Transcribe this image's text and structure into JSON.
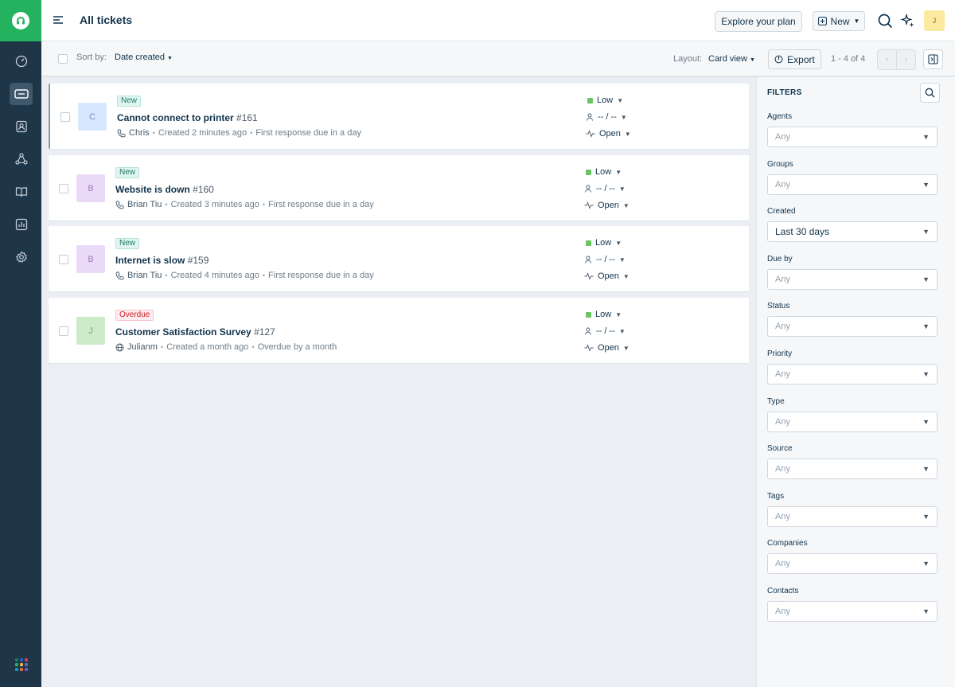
{
  "header": {
    "title": "All tickets",
    "explore_label": "Explore your plan",
    "new_label": "New",
    "avatar_initial": "J"
  },
  "rail": {
    "icons": [
      "dashboard-icon",
      "tickets-icon",
      "contacts-icon",
      "social-icon",
      "solutions-icon",
      "reports-icon",
      "admin-icon"
    ],
    "active": "tickets-icon",
    "app_dot_colors": [
      "#1b7a5a",
      "#2c5cc5",
      "#e63946",
      "#25b25f",
      "#f0ad4e",
      "#5c6bc0",
      "#00a3bf",
      "#e36c35",
      "#7e57c2"
    ]
  },
  "toolbar": {
    "sort_label": "Sort by:",
    "sort_value": "Date created",
    "layout_label": "Layout:",
    "layout_value": "Card view",
    "export_label": "Export",
    "page_info": "1 - 4 of 4"
  },
  "tickets": [
    {
      "initial": "C",
      "avatar_bg": "#d7e7ff",
      "avatar_fg": "#6f8fb5",
      "badge": "New",
      "badge_type": "new",
      "subject": "Cannot connect to printer",
      "number": "#161",
      "source_icon": "phone-icon",
      "requester": "Chris",
      "created": "Created 2 minutes ago",
      "due": "First response due in a day",
      "priority": "Low",
      "assignee": "-- / --",
      "status": "Open",
      "selected": true
    },
    {
      "initial": "B",
      "avatar_bg": "#ead9f7",
      "avatar_fg": "#a27fbd",
      "badge": "New",
      "badge_type": "new",
      "subject": "Website is down",
      "number": "#160",
      "source_icon": "phone-icon",
      "requester": "Brian Tiu",
      "created": "Created 3 minutes ago",
      "due": "First response due in a day",
      "priority": "Low",
      "assignee": "-- / --",
      "status": "Open",
      "selected": false
    },
    {
      "initial": "B",
      "avatar_bg": "#ead9f7",
      "avatar_fg": "#a27fbd",
      "badge": "New",
      "badge_type": "new",
      "subject": "Internet is slow",
      "number": "#159",
      "source_icon": "phone-icon",
      "requester": "Brian Tiu",
      "created": "Created 4 minutes ago",
      "due": "First response due in a day",
      "priority": "Low",
      "assignee": "-- / --",
      "status": "Open",
      "selected": false
    },
    {
      "initial": "J",
      "avatar_bg": "#cdebc9",
      "avatar_fg": "#6ea867",
      "badge": "Overdue",
      "badge_type": "overdue",
      "subject": "Customer Satisfaction Survey",
      "number": "#127",
      "source_icon": "globe-icon",
      "requester": "Julianm",
      "created": "Created a month ago",
      "due": "Overdue by a month",
      "priority": "Low",
      "assignee": "-- / --",
      "status": "Open",
      "selected": false
    }
  ],
  "filters": {
    "title": "FILTERS",
    "fields": [
      {
        "label": "Agents",
        "value": "Any",
        "filled": false
      },
      {
        "label": "Groups",
        "value": "Any",
        "filled": false
      },
      {
        "label": "Created",
        "value": "Last 30 days",
        "filled": true
      },
      {
        "label": "Due by",
        "value": "Any",
        "filled": false
      },
      {
        "label": "Status",
        "value": "Any",
        "filled": false
      },
      {
        "label": "Priority",
        "value": "Any",
        "filled": false
      },
      {
        "label": "Type",
        "value": "Any",
        "filled": false
      },
      {
        "label": "Source",
        "value": "Any",
        "filled": false
      },
      {
        "label": "Tags",
        "value": "Any",
        "filled": false
      },
      {
        "label": "Companies",
        "value": "Any",
        "filled": false
      },
      {
        "label": "Contacts",
        "value": "Any",
        "filled": false
      }
    ]
  }
}
